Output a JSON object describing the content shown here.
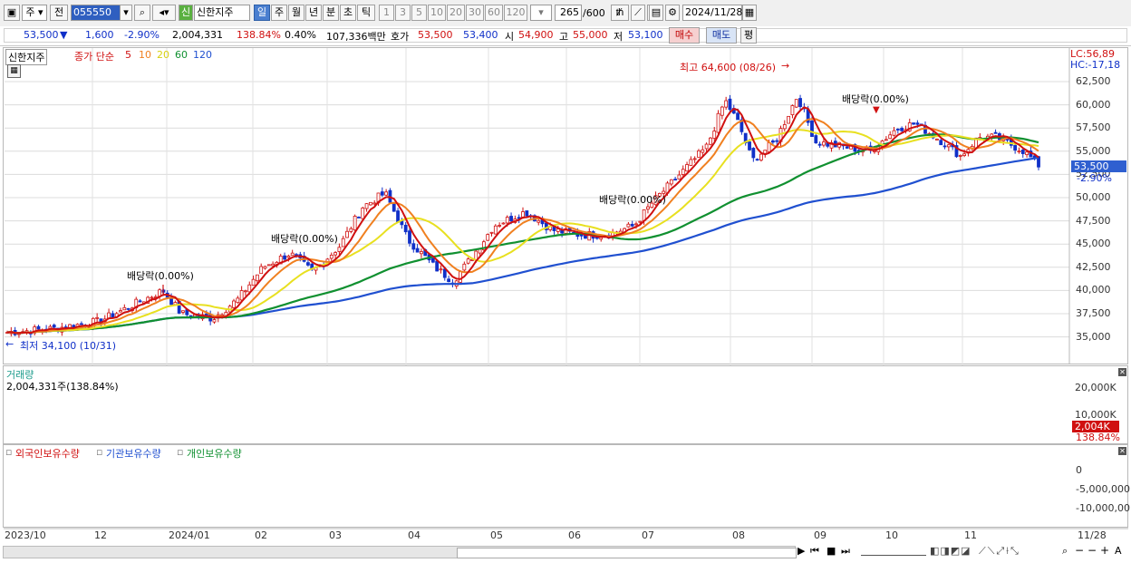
{
  "toolbar": {
    "code": "055550",
    "market": "주",
    "prev": "전",
    "credit_badge": "신",
    "stock_name": "신한지주",
    "periods": [
      "일",
      "주",
      "월",
      "년",
      "분",
      "초",
      "틱"
    ],
    "intervals": [
      "1",
      "3",
      "5",
      "10",
      "20",
      "30",
      "60",
      "120"
    ],
    "count": "265",
    "count_max": "/600",
    "date": "2024/11/28"
  },
  "quote": {
    "price": "53,500",
    "change": "1,600",
    "change_pct": "-2.90%",
    "volume": "2,004,331",
    "vol_ratio": "138.84%",
    "turnover": "0.40%",
    "amount": "107,336백만",
    "bid_label": "호가",
    "bid1": "53,500",
    "bid2": "53,400",
    "open_label": "시",
    "open": "54,900",
    "high_label": "고",
    "high": "55,000",
    "low_label": "저",
    "low": "53,100",
    "buy": "매수",
    "sell": "매도",
    "eval": "평"
  },
  "price_panel": {
    "name_tag": "신한지주",
    "legend_prefix": "종가 단순",
    "ma_legend": [
      {
        "label": "5",
        "color": "#d01010"
      },
      {
        "label": "10",
        "color": "#f08020"
      },
      {
        "label": "20",
        "color": "#e8e020"
      },
      {
        "label": "60",
        "color": "#109030"
      },
      {
        "label": "120",
        "color": "#2050d0"
      }
    ],
    "lc": "LC:56,89",
    "hc": "HC:-17,18",
    "y_labels": [
      "62,500",
      "60,000",
      "57,500",
      "55,000",
      "52,500",
      "50,000",
      "47,500",
      "45,000",
      "42,500",
      "40,000",
      "37,500",
      "35,000"
    ],
    "current_price_tag": "53,500",
    "current_pct_tag": "-2.90%",
    "annotations": {
      "high": "최고 64,600 (08/26)",
      "low": "최저 34,100 (10/31)",
      "div1": "배당락(0.00%)",
      "div2": "배당락(0.00%)",
      "div3": "배당락(0.00%)",
      "div4": "배당락(0.00%)"
    }
  },
  "volume_panel": {
    "title": "거래량",
    "value": "2,004,331주(138.84%)",
    "y_labels": [
      "20,000K",
      "10,000K"
    ],
    "tag_value": "2,004K",
    "tag_pct": "138.84%"
  },
  "holding_panel": {
    "legend": [
      {
        "label": "외국인보유수량",
        "color": "#d01010"
      },
      {
        "label": "기관보유수량",
        "color": "#2050d0"
      },
      {
        "label": "개인보유수량",
        "color": "#109030"
      }
    ],
    "y_labels": [
      "0",
      "-5,000,000",
      "-10,000,00"
    ]
  },
  "x_axis": {
    "labels": [
      "2023/10",
      "12",
      "2024/01",
      "02",
      "03",
      "04",
      "05",
      "06",
      "07",
      "08",
      "09",
      "10",
      "11"
    ],
    "right_label": "11/28"
  },
  "colors": {
    "ma5": "#d01010",
    "ma10": "#f08020",
    "ma20": "#e8e020",
    "ma60": "#109030",
    "ma120": "#2050d0",
    "up": "#d01010",
    "down": "#1030c8"
  }
}
